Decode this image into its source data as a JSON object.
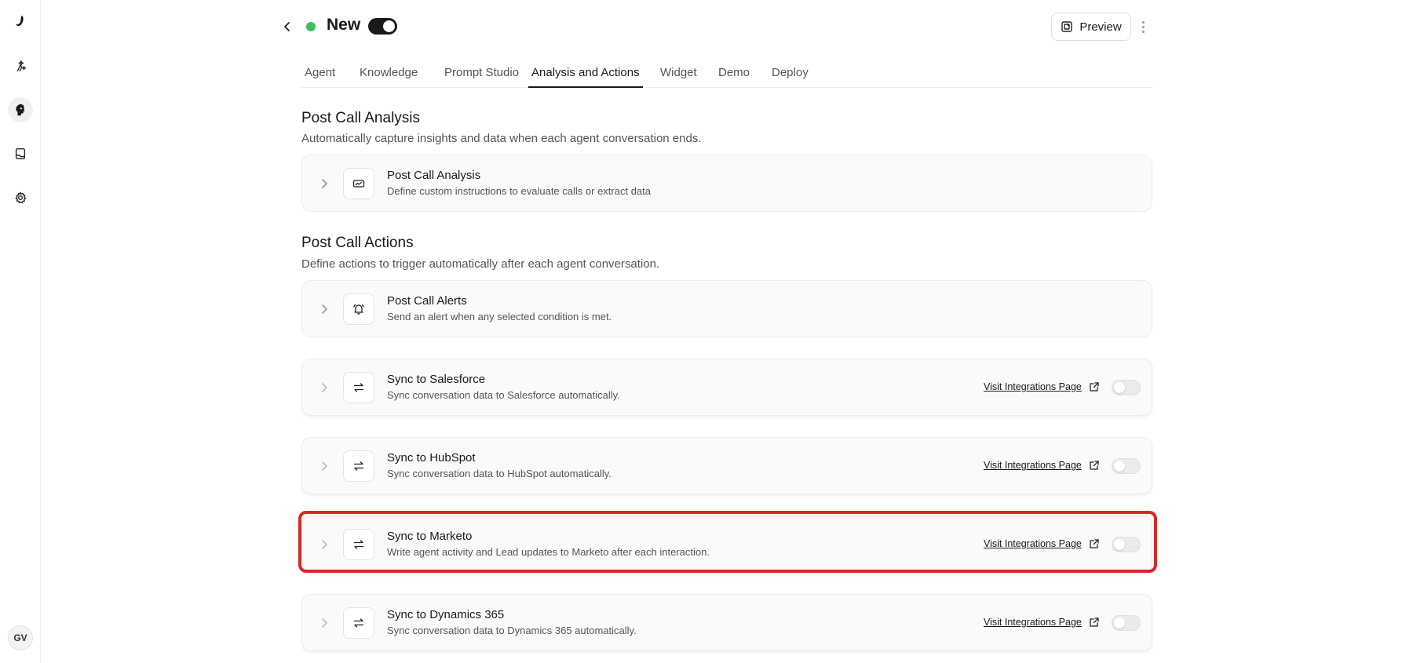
{
  "sidebar": {
    "items": [
      {
        "name": "logo",
        "icon": "logo-icon"
      },
      {
        "name": "agents",
        "icon": "agent-sparkle-icon"
      },
      {
        "name": "ai-agent",
        "icon": "ai-head-icon"
      },
      {
        "name": "conversations",
        "icon": "document-icon"
      },
      {
        "name": "settings",
        "icon": "gear-icon"
      }
    ],
    "avatar": "GV"
  },
  "header": {
    "agent_name": "New",
    "status_color": "#3fbf5a",
    "preview_label": "Preview"
  },
  "tabs": [
    {
      "label": "Agent",
      "active": false
    },
    {
      "label": "Knowledge",
      "active": false
    },
    {
      "label": "Prompt Studio",
      "active": false
    },
    {
      "label": "Analysis and Actions",
      "active": true
    },
    {
      "label": "Widget",
      "active": false
    },
    {
      "label": "Demo",
      "active": false
    },
    {
      "label": "Deploy",
      "active": false
    }
  ],
  "analysis_section": {
    "title": "Post Call Analysis",
    "description": "Automatically capture insights and data when each agent conversation ends.",
    "cards": [
      {
        "title": "Post Call Analysis",
        "description": "Define custom instructions to evaluate calls or extract data",
        "icon": "ticket-icon"
      }
    ]
  },
  "actions_section": {
    "title": "Post Call Actions",
    "description": "Define actions to trigger automatically after each agent conversation.",
    "cards": [
      {
        "title": "Post Call Alerts",
        "description": "Send an alert when any selected condition is met.",
        "icon": "bell-icon"
      },
      {
        "title": "Sync to Salesforce",
        "description": "Sync conversation data to Salesforce automatically.",
        "icon": "sync-arrows-icon",
        "link": "Visit Integrations Page",
        "enabled": false
      },
      {
        "title": "Sync to HubSpot",
        "description": "Sync conversation data to HubSpot automatically.",
        "icon": "sync-arrows-icon",
        "link": "Visit Integrations Page",
        "enabled": false
      },
      {
        "title": "Sync to Marketo",
        "description": "Write agent activity and Lead updates to Marketo after each interaction.",
        "icon": "sync-arrows-icon",
        "link": "Visit Integrations Page",
        "enabled": false
      },
      {
        "title": "Sync to Dynamics 365",
        "description": "Sync conversation data to Dynamics 365 automatically.",
        "icon": "sync-arrows-icon",
        "link": "Visit Integrations Page",
        "enabled": false
      }
    ]
  },
  "highlight_color": "#d42a2a"
}
